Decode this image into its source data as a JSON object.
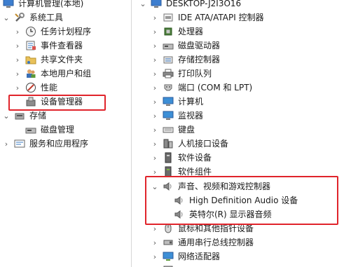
{
  "left_tree": {
    "root": "计算机管理(本地)",
    "system_tools": "系统工具",
    "task_scheduler": "任务计划程序",
    "event_viewer": "事件查看器",
    "shared_folders": "共享文件夹",
    "local_users": "本地用户和组",
    "performance": "性能",
    "device_manager": "设备管理器",
    "storage": "存储",
    "disk_management": "磁盘管理",
    "services": "服务和应用程序"
  },
  "device_tree": {
    "computer_name": "DESKTOP-J2I3O16",
    "ide": "IDE ATA/ATAPI 控制器",
    "processors": "处理器",
    "disk_drives": "磁盘驱动器",
    "storage_controllers": "存储控制器",
    "print_queues": "打印队列",
    "ports": "端口 (COM 和 LPT)",
    "computer": "计算机",
    "monitors": "监视器",
    "keyboards": "键盘",
    "hid": "人机接口设备",
    "software_devices": "软件设备",
    "software_components": "软件组件",
    "sound": "声音、视频和游戏控制器",
    "hd_audio": "High Definition Audio 设备",
    "intel_display_audio": "英特尔(R) 显示器音频",
    "mice": "鼠标和其他指针设备",
    "usb": "通用串行总线控制器",
    "network": "网络适配器"
  }
}
